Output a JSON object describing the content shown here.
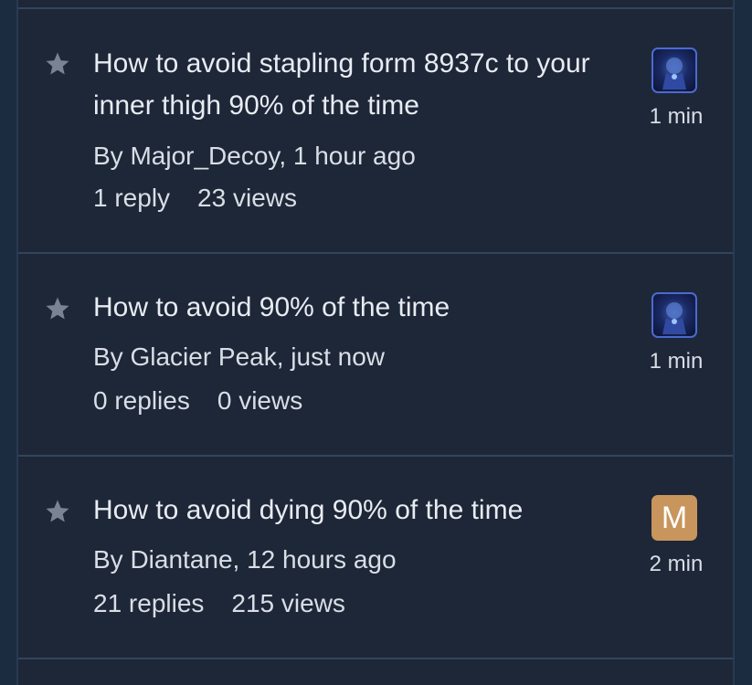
{
  "topics": [
    {
      "title": "How to avoid stapling form 8937c to your inner thigh 90% of the time",
      "byline": "By Major_Decoy, 1 hour ago",
      "replies": "1 reply",
      "views": "23 views",
      "time": "1 min",
      "avatar_type": "image"
    },
    {
      "title": "How to avoid 90% of the time",
      "byline": "By Glacier Peak, just now",
      "replies": "0 replies",
      "views": "0 views",
      "time": "1 min",
      "avatar_type": "image"
    },
    {
      "title": "How to avoid dying 90% of the time",
      "byline": "By Diantane, 12 hours ago",
      "replies": "21 replies",
      "views": "215 views",
      "time": "2 min",
      "avatar_type": "letter",
      "avatar_letter": "M",
      "avatar_color": "#c8955c"
    }
  ],
  "colors": {
    "background": "#1d2738",
    "divider": "#34445a",
    "text": "#e8ecf2",
    "star": "#7a8392"
  }
}
